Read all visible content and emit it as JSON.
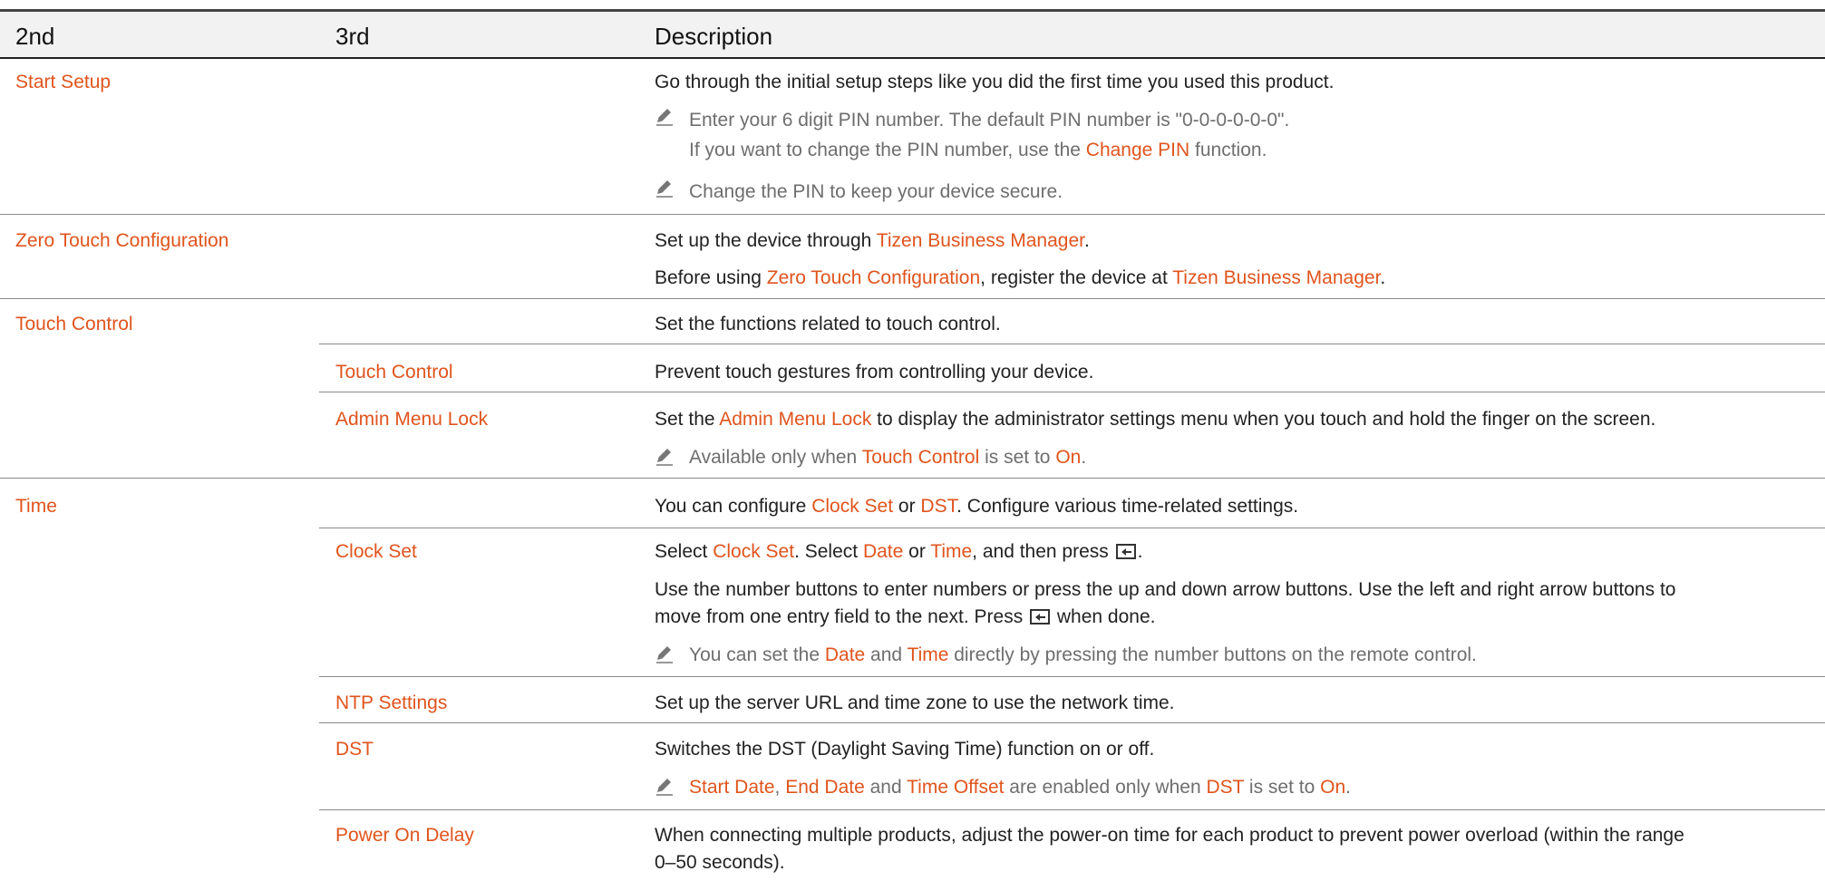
{
  "header": {
    "col2": "2nd",
    "col3": "3rd",
    "desc": "Description"
  },
  "rows": {
    "start_setup": {
      "label": "Start Setup",
      "desc": "Go through the initial setup steps like you did the first time you used this product.",
      "note1_a": "Enter your 6 digit PIN number. The default PIN number is \"0-0-0-0-0-0\".",
      "note1_b": "If you want to change the PIN number, use the ",
      "note1_link": "Change PIN",
      "note1_c": " function.",
      "note2": "Change the PIN to keep your device secure."
    },
    "zero_touch": {
      "label": "Zero Touch Configuration",
      "line1_a": "Set up the device through ",
      "line1_link": "Tizen Business Manager",
      "line1_b": ".",
      "line2_a": "Before using ",
      "line2_link1": "Zero Touch Configuration",
      "line2_b": ", register the device at ",
      "line2_link2": "Tizen Business Manager",
      "line2_c": "."
    },
    "touch_control": {
      "label": "Touch Control",
      "desc": "Set the functions related to touch control.",
      "sub1_label": "Touch Control",
      "sub1_desc": "Prevent touch gestures from controlling your device.",
      "sub2_label": "Admin Menu Lock",
      "sub2_a": "Set the ",
      "sub2_link": "Admin Menu Lock",
      "sub2_b": " to display the administrator settings menu when you touch and hold the finger on the screen.",
      "note_a": "Available only when ",
      "note_link1": "Touch Control",
      "note_b": " is set to ",
      "note_link2": "On",
      "note_c": "."
    },
    "time": {
      "label": "Time",
      "desc_a": "You can configure ",
      "desc_link1": "Clock Set",
      "desc_b": " or ",
      "desc_link2": "DST",
      "desc_c": ". Configure various time-related settings.",
      "clock_label": "Clock Set",
      "clock_1a": "Select ",
      "clock_1link": "Clock Set",
      "clock_1b": ". Select ",
      "clock_1link2": "Date",
      "clock_1c": " or ",
      "clock_1link3": "Time",
      "clock_1d": ", and then press ",
      "clock_1e": ".",
      "clock_2": "Use the number buttons to enter numbers or press the up and down arrow buttons. Use the left and right arrow buttons to",
      "clock_3a": "move from one entry field to the next. Press ",
      "clock_3b": " when done.",
      "clock_note_a": "You can set the ",
      "clock_note_link1": "Date",
      "clock_note_b": " and ",
      "clock_note_link2": "Time",
      "clock_note_c": " directly by pressing the number buttons on the remote control.",
      "ntp_label": "NTP Settings",
      "ntp_desc": "Set up the server URL and time zone to use the network time.",
      "dst_label": "DST",
      "dst_desc": "Switches the DST (Daylight Saving Time) function on or off.",
      "dst_note_link1": "Start Date",
      "dst_note_a": ", ",
      "dst_note_link2": "End Date",
      "dst_note_b": " and ",
      "dst_note_link3": "Time Offset",
      "dst_note_c": " are enabled only when ",
      "dst_note_link4": "DST",
      "dst_note_d": " is set to ",
      "dst_note_link5": "On",
      "dst_note_e": ".",
      "pod_label": "Power On Delay",
      "pod_desc1": "When connecting multiple products, adjust the power-on time for each product to prevent power overload (within the range",
      "pod_desc2": "0–50 seconds)."
    }
  },
  "icons": {
    "note": "pencil-note-icon",
    "enter": "enter-key-icon"
  }
}
